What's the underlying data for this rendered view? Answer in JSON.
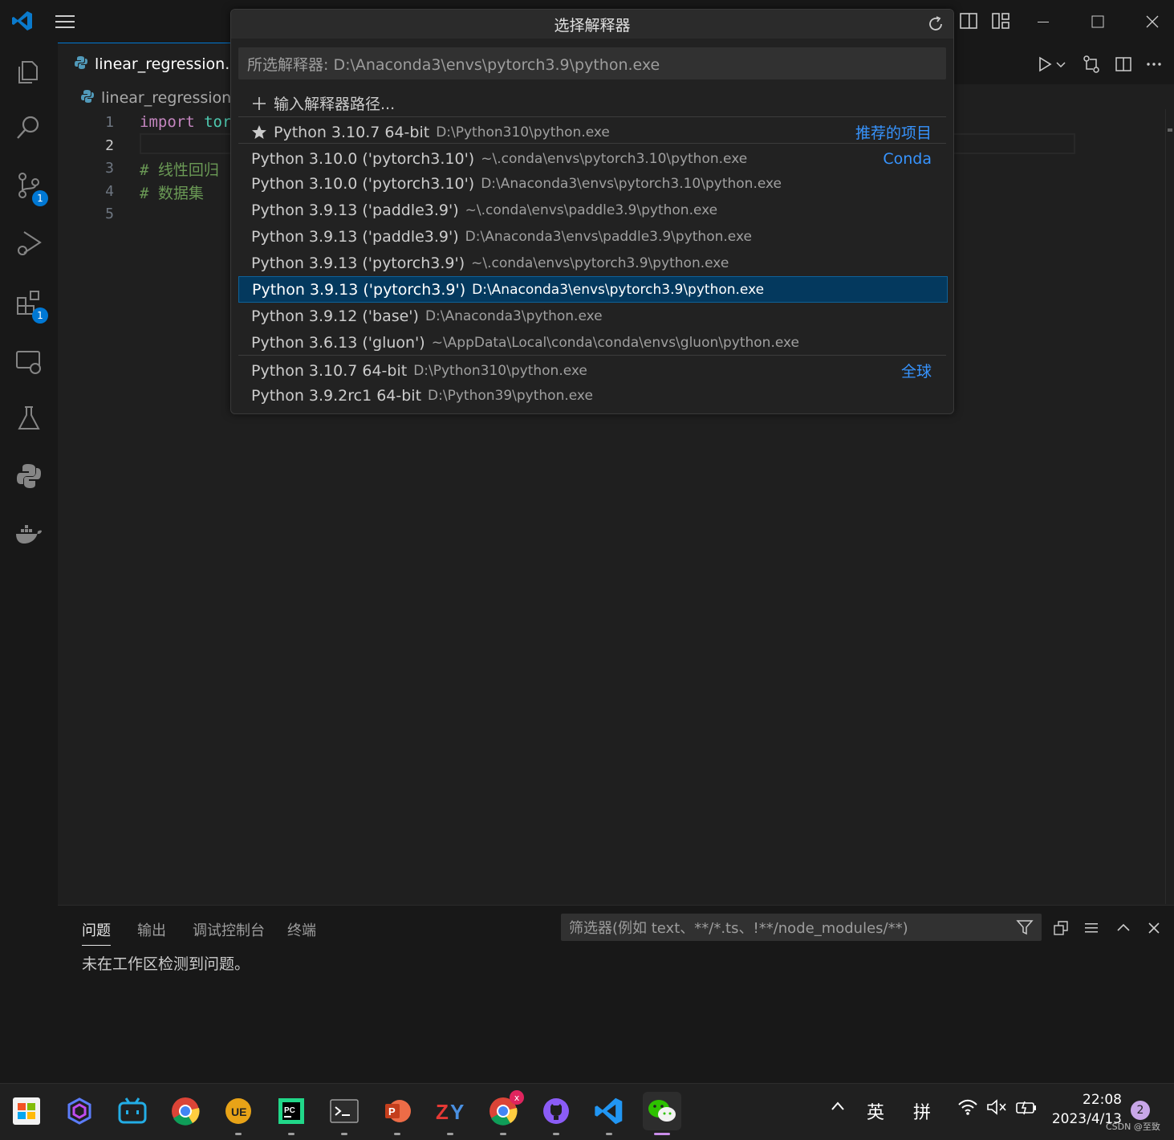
{
  "editor": {
    "tab_label": "linear_regression.py",
    "breadcrumb": "linear_regression.p",
    "lines": [
      {
        "num": "1",
        "keyword": "import",
        "rest": "tor"
      },
      {
        "num": "2",
        "keyword": "",
        "rest": ""
      },
      {
        "num": "3",
        "keyword": "",
        "rest": "# 线性回归"
      },
      {
        "num": "4",
        "keyword": "",
        "rest": "# 数据集"
      },
      {
        "num": "5",
        "keyword": "",
        "rest": ""
      }
    ]
  },
  "activity_bar": {
    "scm_badge": "1",
    "extensions_badge": "1"
  },
  "quick_pick": {
    "title": "选择解释器",
    "input_value": "所选解释器: D:\\Anaconda3\\envs\\pytorch3.9\\python.exe",
    "enter_path": "输入解释器路径...",
    "items": [
      {
        "label": "Python 3.10.7 64-bit",
        "desc": "D:\\Python310\\python.exe",
        "group": "推荐的项目"
      },
      {
        "label": "Python 3.10.0 ('pytorch3.10')",
        "desc": "~\\.conda\\envs\\pytorch3.10\\python.exe",
        "group": "Conda"
      },
      {
        "label": "Python 3.10.0 ('pytorch3.10')",
        "desc": "D:\\Anaconda3\\envs\\pytorch3.10\\python.exe",
        "group": ""
      },
      {
        "label": "Python 3.9.13 ('paddle3.9')",
        "desc": "~\\.conda\\envs\\paddle3.9\\python.exe",
        "group": ""
      },
      {
        "label": "Python 3.9.13 ('paddle3.9')",
        "desc": "D:\\Anaconda3\\envs\\paddle3.9\\python.exe",
        "group": ""
      },
      {
        "label": "Python 3.9.13 ('pytorch3.9')",
        "desc": "~\\.conda\\envs\\pytorch3.9\\python.exe",
        "group": ""
      },
      {
        "label": "Python 3.9.13 ('pytorch3.9')",
        "desc": "D:\\Anaconda3\\envs\\pytorch3.9\\python.exe",
        "group": ""
      },
      {
        "label": "Python 3.9.12 ('base')",
        "desc": "D:\\Anaconda3\\python.exe",
        "group": ""
      },
      {
        "label": "Python 3.6.13 ('gluon')",
        "desc": "~\\AppData\\Local\\conda\\conda\\envs\\gluon\\python.exe",
        "group": ""
      },
      {
        "label": "Python 3.10.7 64-bit",
        "desc": "D:\\Python310\\python.exe",
        "group": "全球"
      },
      {
        "label": "Python 3.9.2rc1 64-bit",
        "desc": "D:\\Python39\\python.exe",
        "group": ""
      }
    ]
  },
  "panel": {
    "tabs": [
      "问题",
      "输出",
      "调试控制台",
      "终端"
    ],
    "filter_placeholder": "筛选器(例如 text、**/*.ts、!**/node_modules/**)",
    "message": "未在工作区检测到问题。"
  },
  "taskbar": {
    "tray_lang": "英",
    "tray_ime": "拼",
    "time": "22:08",
    "date": "2023/4/13",
    "notifications": "2",
    "chrome_badge": "x",
    "watermark": "CSDN @至致"
  },
  "colors": {
    "accent": "#0078d4",
    "selection": "#04395e",
    "group_label": "#3794ff"
  }
}
